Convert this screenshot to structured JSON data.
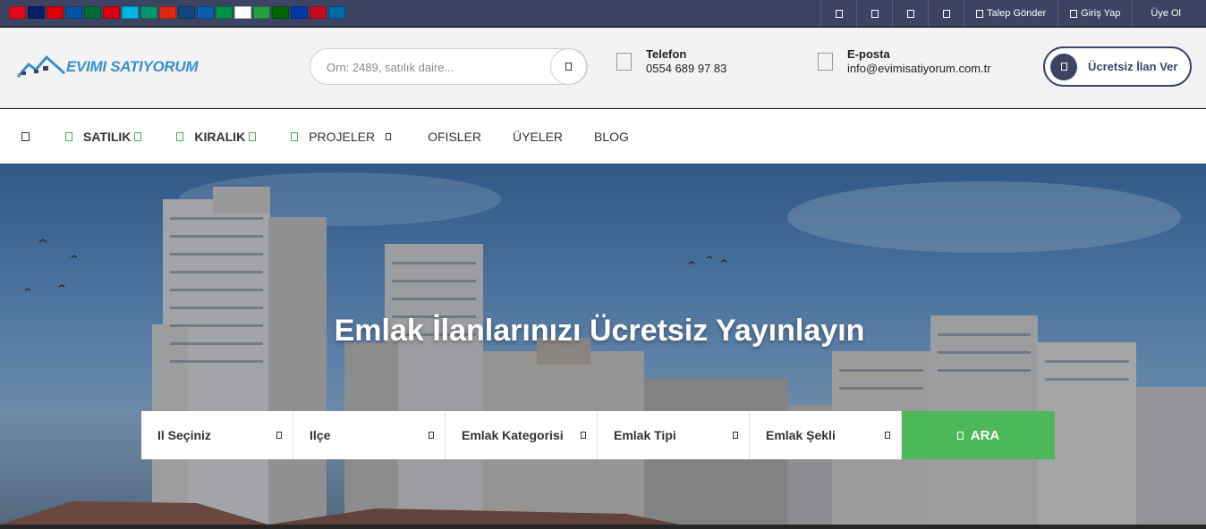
{
  "topbar": {
    "flags": [
      {
        "name": "turkey",
        "color": "#e30a17"
      },
      {
        "name": "uk",
        "color": "#012169"
      },
      {
        "name": "germany",
        "color": "#dd0000"
      },
      {
        "name": "france",
        "color": "#0055a4"
      },
      {
        "name": "arabic",
        "color": "#006c35"
      },
      {
        "name": "armenia",
        "color": "#d90012"
      },
      {
        "name": "azerbaijan",
        "color": "#00b5e2"
      },
      {
        "name": "bulgaria",
        "color": "#00966e"
      },
      {
        "name": "china",
        "color": "#de2910"
      },
      {
        "name": "czech",
        "color": "#11457e"
      },
      {
        "name": "greece",
        "color": "#0d5eaf"
      },
      {
        "name": "italy",
        "color": "#009246"
      },
      {
        "name": "japan",
        "color": "#ffffff"
      },
      {
        "name": "iran",
        "color": "#239f40"
      },
      {
        "name": "portugal",
        "color": "#006600"
      },
      {
        "name": "russia",
        "color": "#0039a6"
      },
      {
        "name": "spain",
        "color": "#c60b1e"
      },
      {
        "name": "sweden",
        "color": "#006aa7"
      }
    ],
    "links": {
      "request": "Talep Gönder",
      "login": "Giriş Yap",
      "register": "Üye Ol"
    }
  },
  "header": {
    "logo_text": "EVIMI SATIYORUM",
    "search_placeholder": "Orn: 2489, satılık daire...",
    "phone_label": "Telefon",
    "phone_value": "0554 689 97 83",
    "email_label": "E-posta",
    "email_value": "info@evimisatiyorum.com.tr",
    "cta_label": "Ücretsiz İlan Ver"
  },
  "nav": {
    "items": [
      "SATILIK",
      "KIRALIK",
      "PROJELER",
      "OFISLER",
      "ÜYELER",
      "BLOG"
    ]
  },
  "hero": {
    "title": "Emlak İlanlarınızı Ücretsiz Yayınlayın",
    "selects": [
      "Il Seçiniz",
      "Ilçe",
      "Emlak Kategorisi",
      "Emlak Tipi",
      "Emlak Şekli"
    ],
    "search_label": "ARA"
  },
  "colors": {
    "topbar": "#3d4363",
    "accent_green": "#4cb85a",
    "logo_blue": "#3a8fd0"
  }
}
